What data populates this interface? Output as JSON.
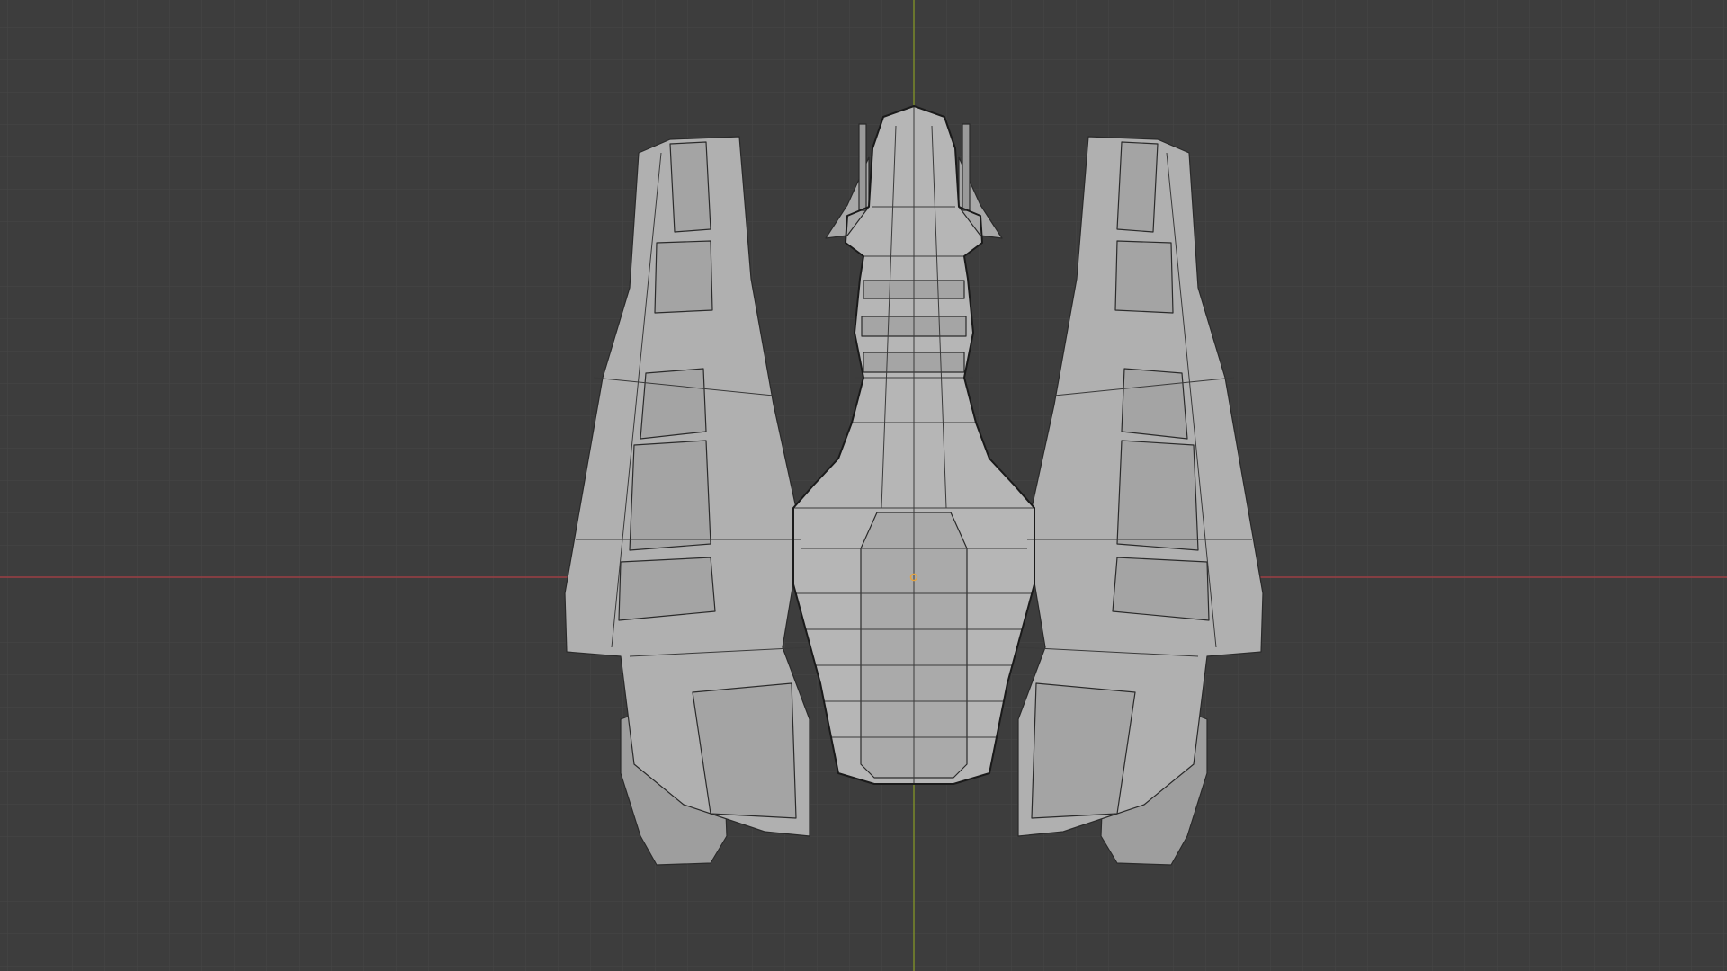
{
  "viewport": {
    "background_color": "#3d3d3d",
    "grid_minor_color": "#464646",
    "grid_major_color": "#4a4a4a",
    "x_axis_color": "#9b3f44",
    "y_axis_color": "#7a8a2a",
    "origin_color": "#e8a33a"
  },
  "model": {
    "surface_light": "#b4b4b4",
    "surface_mid": "#a2a2a2",
    "surface_dark": "#8c8c8c",
    "edge_color": "#2a2a2a",
    "outline_color": "#1a1a1a"
  }
}
